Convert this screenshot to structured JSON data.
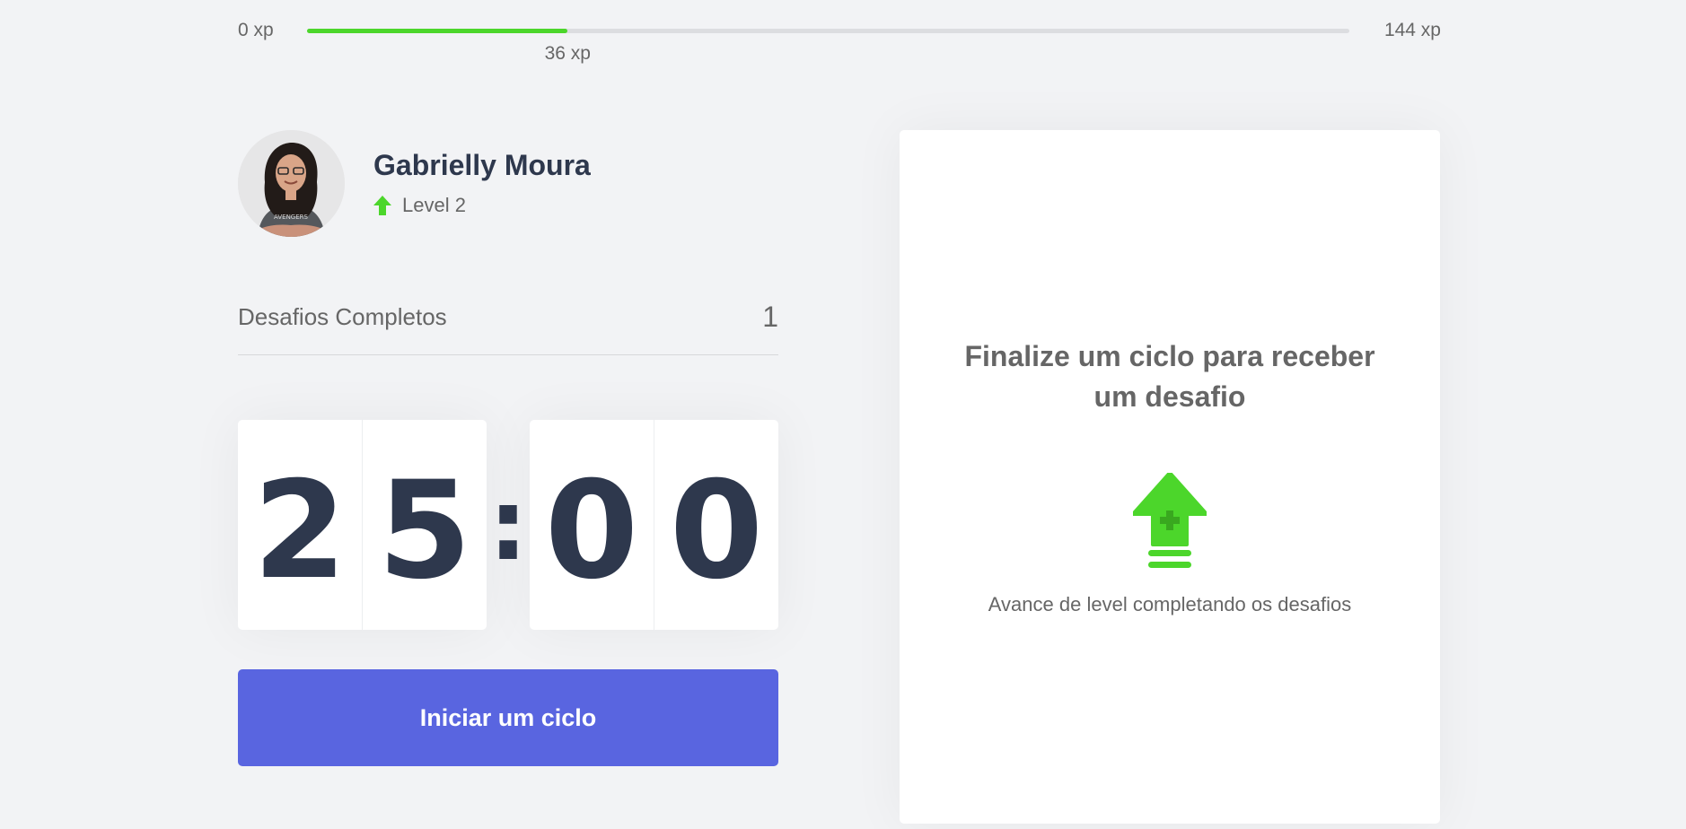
{
  "experience": {
    "min_label": "0 xp",
    "max_label": "144 xp",
    "current_label": "36 xp",
    "current_xp": 36,
    "next_level_xp": 144,
    "fill_color": "#4cd62b"
  },
  "profile": {
    "name": "Gabrielly Moura",
    "level_label": "Level 2",
    "level_icon": "level-up-arrow-icon"
  },
  "completed_challenges": {
    "label": "Desafios Completos",
    "count": "1"
  },
  "countdown": {
    "minutes": [
      "2",
      "5"
    ],
    "separator": ":",
    "seconds": [
      "0",
      "0"
    ]
  },
  "start_button": {
    "label": "Iniciar um ciclo",
    "color": "#5965e0"
  },
  "challenge_box": {
    "title": "Finalize um ciclo para receber um desafio",
    "hint": "Avance de level completando os desafios",
    "icon": "level-up-icon"
  }
}
